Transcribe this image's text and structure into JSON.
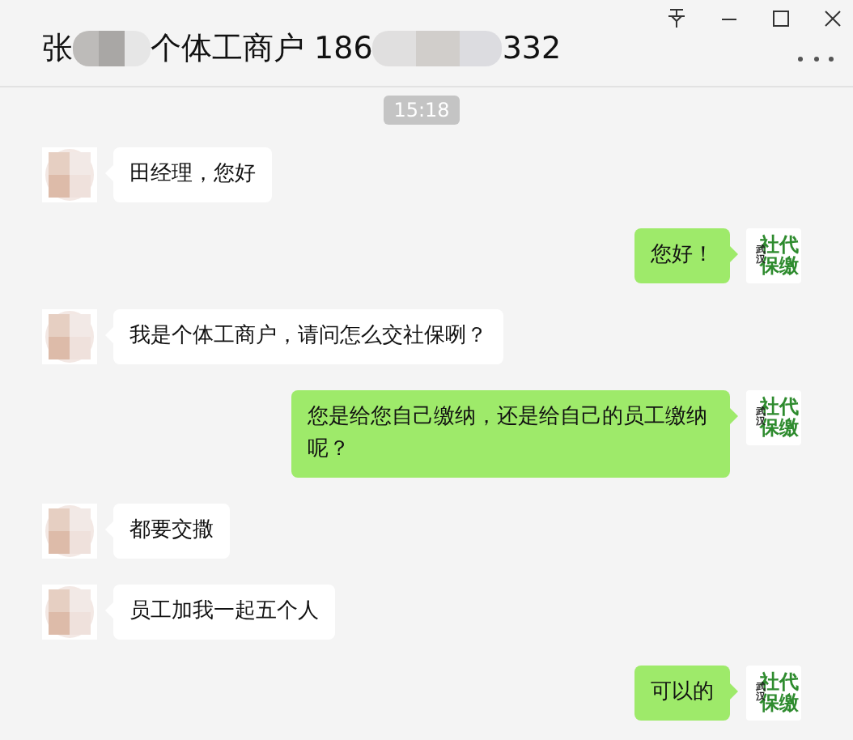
{
  "window": {
    "title_parts": [
      {
        "kind": "text",
        "text": "张"
      },
      {
        "kind": "redacted"
      },
      {
        "kind": "text",
        "text": "个体工商户 186"
      },
      {
        "kind": "redacted"
      },
      {
        "kind": "text",
        "text": "332"
      }
    ]
  },
  "timestamp": "15:18",
  "messages": [
    {
      "kind": "received",
      "text": "田经理，您好"
    },
    {
      "kind": "sent",
      "text": "您好！",
      "logo": {
        "small": "武汉",
        "top": "社代",
        "bottom": "保缴"
      }
    },
    {
      "kind": "received",
      "text": "我是个体工商户，请问怎么交社保咧？"
    },
    {
      "kind": "sent",
      "text": "您是给您自己缴纳，还是给自己的员工缴纳呢？",
      "logo": {
        "small": "武汉",
        "top": "社代",
        "bottom": "保缴"
      }
    },
    {
      "kind": "received",
      "text": "都要交撒"
    },
    {
      "kind": "received",
      "text": "员工加我一起五个人"
    },
    {
      "kind": "sent",
      "text": "可以的",
      "logo": {
        "small": "武汉",
        "top": "社代",
        "bottom": "保缴"
      }
    }
  ]
}
